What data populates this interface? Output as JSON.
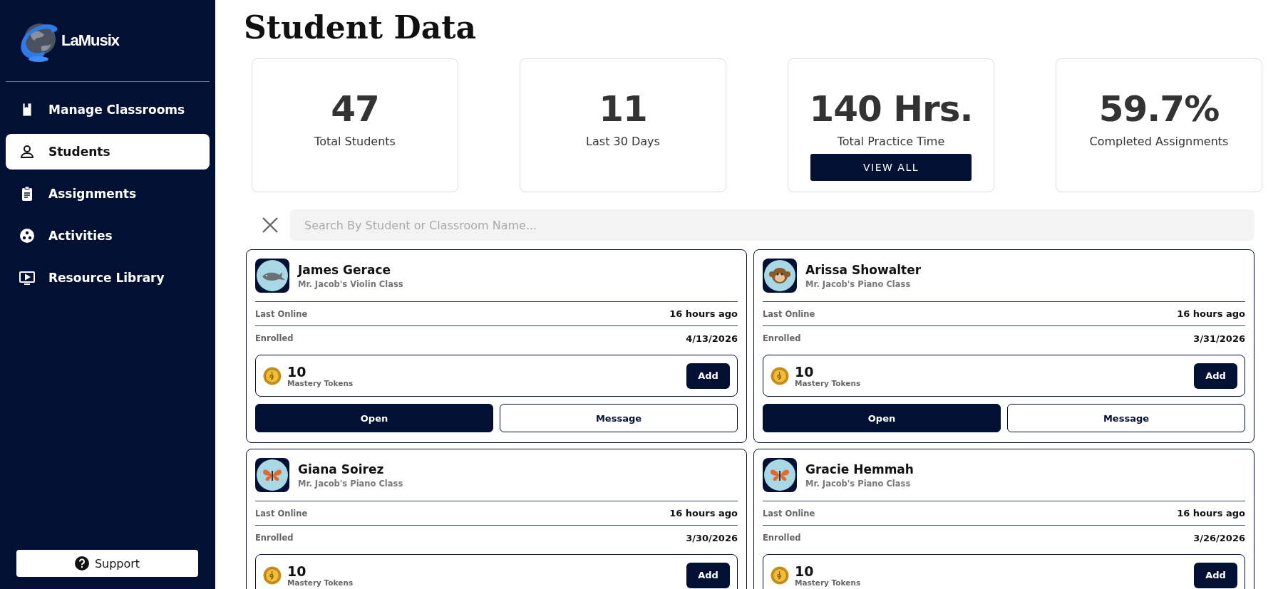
{
  "sidebar": {
    "logo": "LaMusix",
    "items": [
      {
        "label": "Manage Classrooms",
        "kind": "classrooms",
        "selected": false
      },
      {
        "label": "Students",
        "kind": "students",
        "selected": true
      },
      {
        "label": "Assignments",
        "kind": "assignments",
        "selected": false
      },
      {
        "label": "Activities",
        "kind": "activities",
        "selected": false
      },
      {
        "label": "Resource Library",
        "kind": "library",
        "selected": false
      }
    ],
    "support": "Support"
  },
  "title": "Student Data",
  "stats": [
    {
      "value": "47",
      "label": "Total Students"
    },
    {
      "value": "11",
      "label": "Last 30 Days"
    },
    {
      "value": "140 Hrs.",
      "label": "Total Practice Time",
      "button": "VIEW ALL"
    },
    {
      "value": "59.7%",
      "label": "Completed Assignments"
    }
  ],
  "search": {
    "placeholder": "Search By Student or Classroom Name..."
  },
  "students": [
    {
      "name": "James Gerace",
      "class": "Mr. Jacob's Violin Class",
      "kind": "whale",
      "last_online_label": "Last Online",
      "last_online": "16 hours ago",
      "enrolled_label": "Enrolled",
      "enrolled": "4/13/2026",
      "tokens": "10",
      "tokens_label": "Mastery Tokens",
      "add": "Add",
      "open": "Open",
      "message": "Message"
    },
    {
      "name": "Arissa Showalter",
      "class": "Mr. Jacob's Piano Class",
      "kind": "monkey",
      "last_online_label": "Last Online",
      "last_online": "16 hours ago",
      "enrolled_label": "Enrolled",
      "enrolled": "3/31/2026",
      "tokens": "10",
      "tokens_label": "Mastery Tokens",
      "add": "Add",
      "open": "Open",
      "message": "Message"
    },
    {
      "name": "Giana Soirez",
      "class": "Mr. Jacob's Piano Class",
      "kind": "butterfly",
      "last_online_label": "Last Online",
      "last_online": "16 hours ago",
      "enrolled_label": "Enrolled",
      "enrolled": "3/30/2026",
      "tokens": "10",
      "tokens_label": "Mastery Tokens",
      "add": "Add"
    },
    {
      "name": "Gracie Hemmah",
      "class": "Mr. Jacob's Piano Class",
      "kind": "butterfly",
      "last_online_label": "Last Online",
      "last_online": "16 hours ago",
      "enrolled_label": "Enrolled",
      "enrolled": "3/26/2026",
      "tokens": "10",
      "tokens_label": "Mastery Tokens",
      "add": "Add"
    }
  ]
}
